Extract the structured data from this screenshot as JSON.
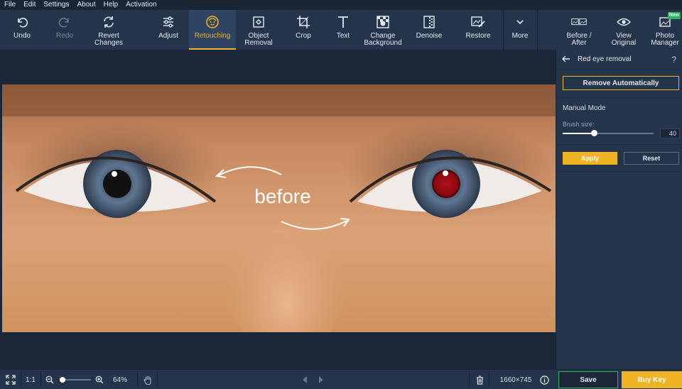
{
  "menu": [
    "File",
    "Edit",
    "Settings",
    "About",
    "Help",
    "Activation"
  ],
  "toolbar": {
    "undo": "Undo",
    "redo": "Redo",
    "revert": "Revert\nChanges",
    "adjust": "Adjust",
    "retouching": "Retouching",
    "object_removal": "Object\nRemoval",
    "crop": "Crop",
    "text": "Text",
    "change_background": "Change\nBackground",
    "denoise": "Denoise",
    "restore": "Restore",
    "more": "More",
    "before_after": "Before /\nAfter",
    "view_original": "View\nOriginal",
    "photo_manager": "Photo\nManager",
    "new_badge": "New",
    "active_tool": "Retouching"
  },
  "canvas": {
    "overlay_text": "before"
  },
  "panel": {
    "title": "Red eye removal",
    "help": "?",
    "remove_auto": "Remove Automatically",
    "manual_mode": "Manual Mode",
    "brush_label": "Brush size:",
    "brush_value": "40",
    "brush_fraction": 0.34,
    "apply": "Apply",
    "reset": "Reset"
  },
  "status": {
    "ratio": "1:1",
    "zoom": "64%",
    "zoom_fraction": 0.1,
    "dimensions": "1660×745",
    "save": "Save",
    "buy": "Buy Key"
  },
  "colors": {
    "accent": "#f0b323",
    "save_border": "#2db35d",
    "toolbar_bg": "#24344a",
    "canvas_bg": "#1b2738"
  }
}
